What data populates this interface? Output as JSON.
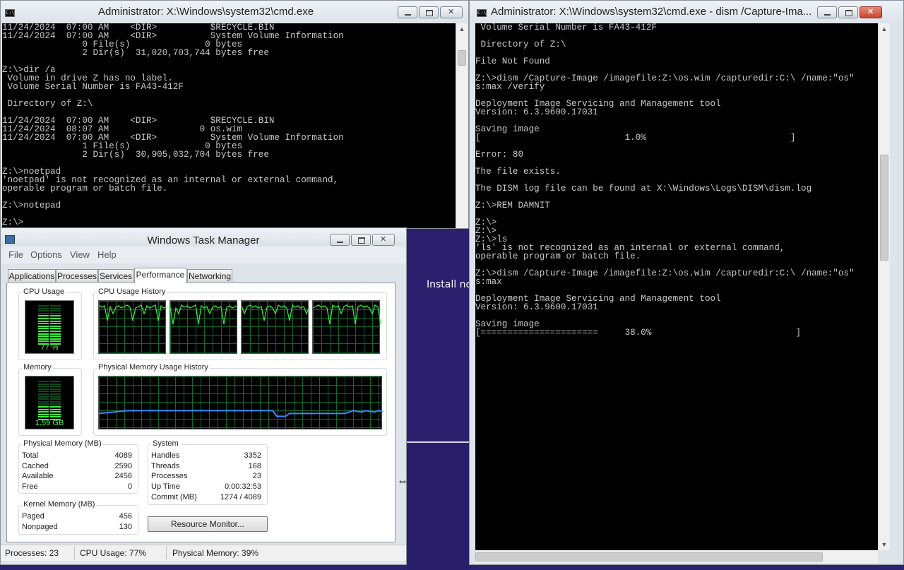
{
  "background": {
    "install_text": "Install no"
  },
  "cmd1": {
    "title": "Administrator: X:\\Windows\\system32\\cmd.exe",
    "lines": [
      "11/24/2024  07:00 AM    <DIR>          $RECYCLE.BIN",
      "11/24/2024  07:00 AM    <DIR>          System Volume Information",
      "               0 File(s)              0 bytes",
      "               2 Dir(s)  31,020,703,744 bytes free",
      "",
      "Z:\\>dir /a",
      " Volume in drive Z has no label.",
      " Volume Serial Number is FA43-412F",
      "",
      " Directory of Z:\\",
      "",
      "11/24/2024  07:00 AM    <DIR>          $RECYCLE.BIN",
      "11/24/2024  08:07 AM                 0 os.wim",
      "11/24/2024  07:00 AM    <DIR>          System Volume Information",
      "               1 File(s)              0 bytes",
      "               2 Dir(s)  30,905,032,704 bytes free",
      "",
      "Z:\\>noetpad",
      "'noetpad' is not recognized as an internal or external command,",
      "operable program or batch file.",
      "",
      "Z:\\>notepad",
      "",
      "Z:\\>"
    ]
  },
  "cmd2": {
    "title": "Administrator: X:\\Windows\\system32\\cmd.exe - dism  /Capture-Ima...",
    "lines": [
      " Volume Serial Number is FA43-412F",
      "",
      " Directory of Z:\\",
      "",
      "File Not Found",
      "",
      "Z:\\>dism /Capture-Image /imagefile:Z:\\os.wim /capturedir:C:\\ /name:\"os\"",
      "s:max /verify",
      "",
      "Deployment Image Servicing and Management tool",
      "Version: 6.3.9600.17031",
      "",
      "Saving image",
      "[                           1.0%                           ]",
      "",
      "Error: 80",
      "",
      "The file exists.",
      "",
      "The DISM log file can be found at X:\\Windows\\Logs\\DISM\\dism.log",
      "",
      "Z:\\>REM DAMNIT",
      "",
      "Z:\\>",
      "Z:\\>",
      "Z:\\>ls",
      "'ls' is not recognized as an internal or external command,",
      "operable program or batch file.",
      "",
      "Z:\\>dism /Capture-Image /imagefile:Z:\\os.wim /capturedir:C:\\ /name:\"os\"",
      "s:max",
      "",
      "Deployment Image Servicing and Management tool",
      "Version: 6.3.9600.17031",
      "",
      "Saving image",
      "[======================     38.0%                           ]"
    ]
  },
  "taskmgr": {
    "title": "Windows Task Manager",
    "menu": [
      "File",
      "Options",
      "View",
      "Help"
    ],
    "tabs": [
      "Applications",
      "Processes",
      "Services",
      "Performance",
      "Networking"
    ],
    "active_tab": "Performance",
    "cpu_usage_label": "CPU Usage",
    "cpu_usage_value": "77 %",
    "cpu_usage_fraction": 0.77,
    "cpu_history_label": "CPU Usage History",
    "memory_label": "Memory",
    "memory_value": "1.59 GB",
    "memory_fraction": 0.39,
    "mem_history_label": "Physical Memory Usage History",
    "physical_memory": {
      "caption": "Physical Memory (MB)",
      "rows": [
        {
          "k": "Total",
          "v": "4089"
        },
        {
          "k": "Cached",
          "v": "2590"
        },
        {
          "k": "Available",
          "v": "2456"
        },
        {
          "k": "Free",
          "v": "0"
        }
      ]
    },
    "kernel_memory": {
      "caption": "Kernel Memory (MB)",
      "rows": [
        {
          "k": "Paged",
          "v": "456"
        },
        {
          "k": "Nonpaged",
          "v": "130"
        }
      ]
    },
    "system": {
      "caption": "System",
      "rows": [
        {
          "k": "Handles",
          "v": "3352"
        },
        {
          "k": "Threads",
          "v": "168"
        },
        {
          "k": "Processes",
          "v": "23"
        },
        {
          "k": "Up Time",
          "v": "0:00:32:53"
        },
        {
          "k": "Commit (MB)",
          "v": "1274 / 4089"
        }
      ]
    },
    "resource_monitor_button": "Resource Monitor...",
    "status": {
      "processes": "Processes: 23",
      "cpu": "CPU Usage: 77%",
      "memory": "Physical Memory: 39%"
    },
    "colors": {
      "graph_line": "#3cf23c",
      "mem_line": "#3a8cff",
      "grid": "#0c6a2c"
    }
  }
}
